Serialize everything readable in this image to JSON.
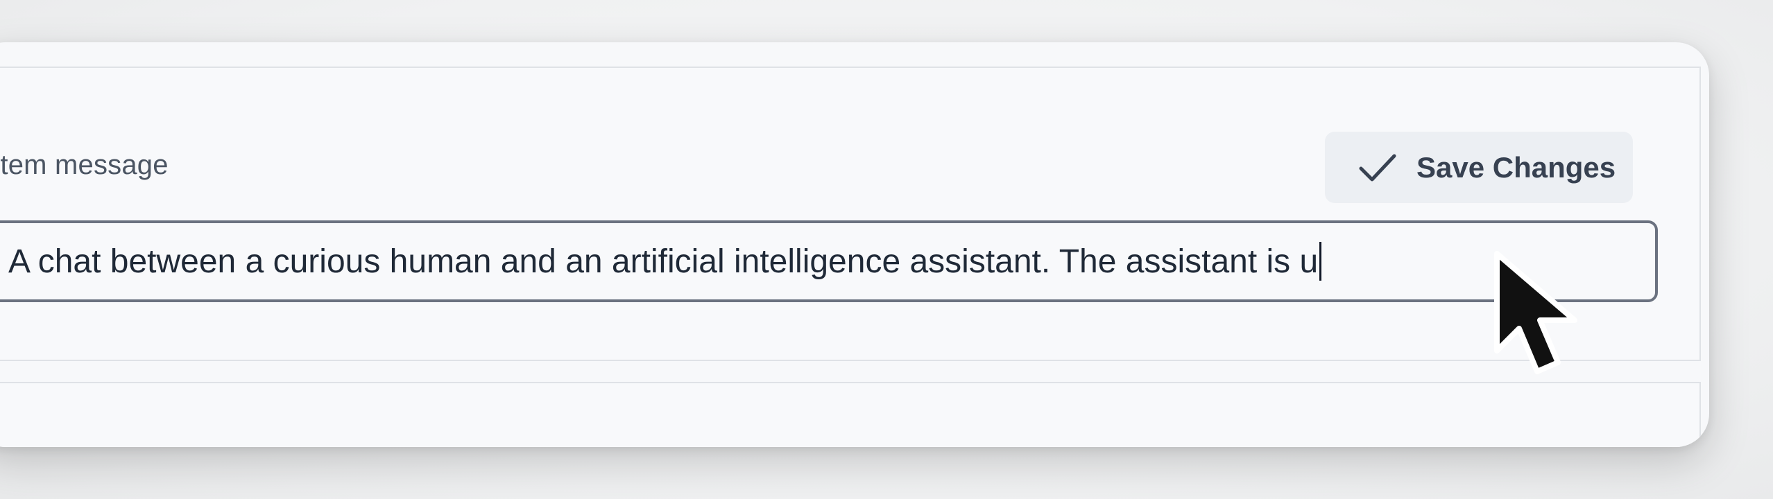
{
  "form": {
    "label": "ystem message",
    "value": "A chat between a curious human and an artificial intelligence assistant. The assistant is u"
  },
  "toolbar": {
    "save_label": "Save Changes",
    "save_icon": "check-icon"
  },
  "pointer": {
    "icon": "mouse-pointer-icon"
  },
  "colors": {
    "border": "#6b7280",
    "button_bg": "#eceff3",
    "text": "#374151"
  }
}
